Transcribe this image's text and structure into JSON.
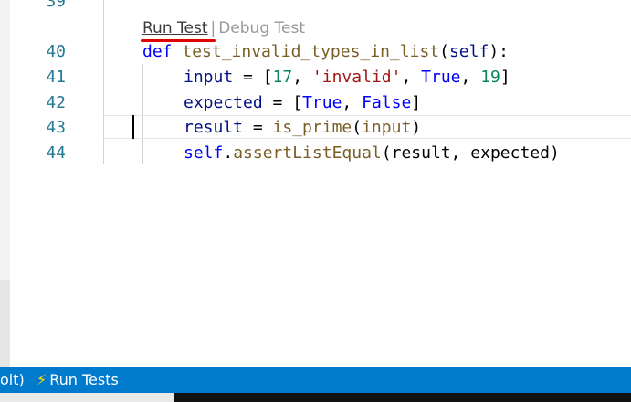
{
  "editor": {
    "top_partial_line_number": "39",
    "codelens": {
      "run_label": "Run Test",
      "separator": "|",
      "debug_label": "Debug Test"
    },
    "lines": [
      {
        "number": "40",
        "tokens": [
          "def",
          " ",
          "test_invalid_types_in_list",
          "(",
          "self",
          "):"
        ]
      },
      {
        "number": "41",
        "tokens": [
          "input",
          " = [",
          "17",
          ", ",
          "'invalid'",
          ", ",
          "True",
          ", ",
          "19",
          "]"
        ]
      },
      {
        "number": "42",
        "tokens": [
          "expected",
          " = [",
          "True",
          ", ",
          "False",
          "]"
        ]
      },
      {
        "number": "43",
        "tokens": [
          "result",
          " = ",
          "is_prime",
          "(",
          "input",
          ")"
        ]
      },
      {
        "number": "44",
        "tokens": [
          "self",
          ".",
          "assertListEqual",
          "(result, expected)"
        ]
      }
    ]
  },
  "statusbar": {
    "left_fragment": "oit)",
    "run_tests_icon": "lightning-bolt-icon",
    "run_tests_label": "Run Tests"
  },
  "colors": {
    "statusbar_bg": "#007acc",
    "annotation_underline": "#e00000",
    "line_number": "#237893"
  }
}
